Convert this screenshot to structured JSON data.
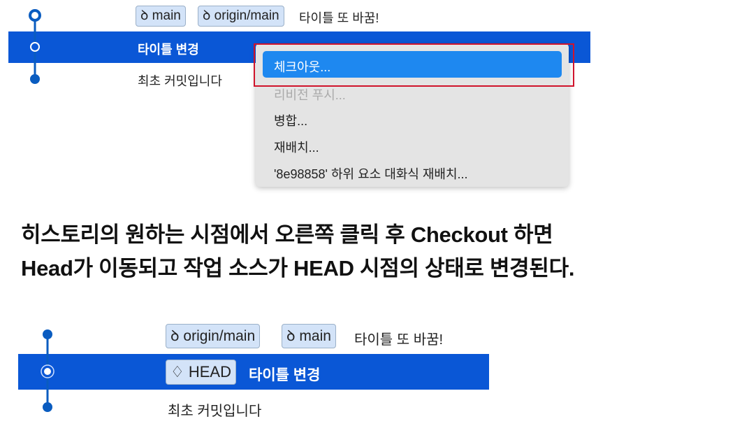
{
  "before": {
    "commits": [
      {
        "badges": [
          {
            "icon": "branch-icon",
            "label": "main"
          },
          {
            "icon": "branch-icon",
            "label": "origin/main"
          }
        ],
        "message": "타이틀 또 바꿈!"
      },
      {
        "message": "타이틀 변경",
        "selected": true
      },
      {
        "message": "최초 커밋입니다"
      }
    ],
    "context_menu": {
      "items": [
        {
          "label": "체크아웃...",
          "highlighted": true
        },
        {
          "label": "리비전 푸시...",
          "disabled": true
        },
        {
          "label": "병합..."
        },
        {
          "label": "재배치..."
        },
        {
          "label": "'8e98858' 하위 요소 대화식 재배치..."
        }
      ]
    }
  },
  "caption": {
    "line1": "히스토리의 원하는 시점에서 오른쪽 클릭 후 Checkout 하면",
    "line2": "Head가 이동되고 작업 소스가 HEAD 시점의 상태로 변경된다."
  },
  "after": {
    "commits": [
      {
        "badges": [
          {
            "icon": "branch-icon",
            "label": "origin/main"
          },
          {
            "icon": "branch-icon",
            "label": "main"
          }
        ],
        "message": "타이틀 또 바꿈!"
      },
      {
        "badges": [
          {
            "icon": "tag-icon",
            "label": "HEAD"
          }
        ],
        "message": "타이틀 변경",
        "selected": true
      },
      {
        "message": "최초 커밋입니다"
      }
    ]
  },
  "colors": {
    "selection": "#0a57d6",
    "highlight": "#1e88f0",
    "annotation": "#d0142c"
  }
}
